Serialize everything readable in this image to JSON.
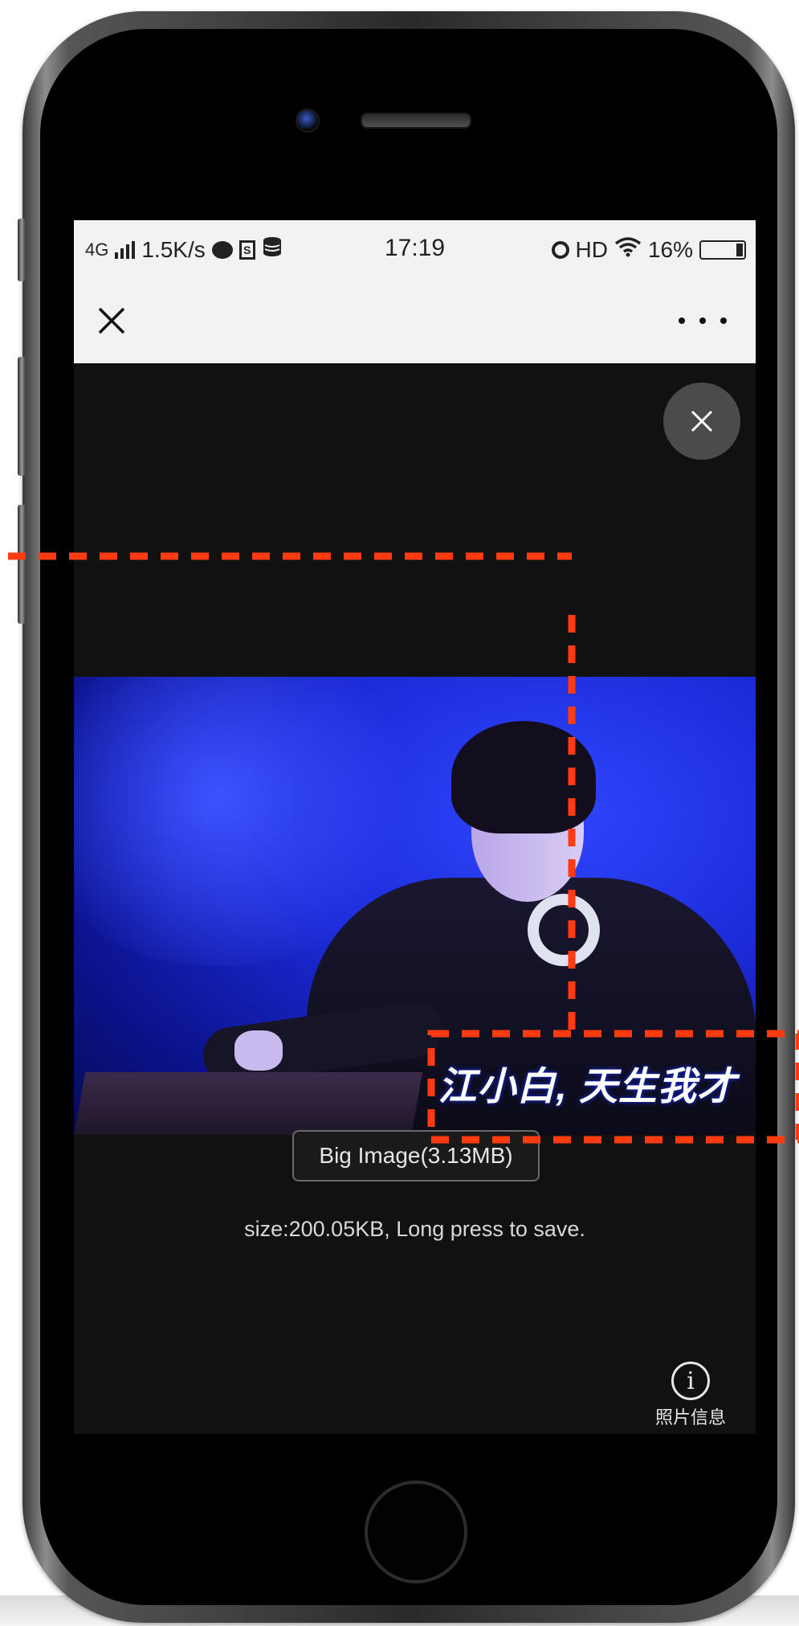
{
  "status_bar": {
    "network": "4G",
    "speed": "1.5K/s",
    "app_icon_label": "S",
    "time": "17:19",
    "hd": "HD",
    "battery": "16%"
  },
  "top_bar": {
    "close_icon": "close-icon",
    "more_icon": "more-icon"
  },
  "viewer": {
    "photo_logo": "江小白, 天生我才",
    "big_image_button": "Big Image(3.13MB)",
    "size_text": "size:200.05KB, Long press to save.",
    "photo_info_label": "照片信息",
    "info_icon_glyph": "i"
  },
  "colors": {
    "annotation": "#ff3b12",
    "screen_bg": "#111111",
    "bar_bg": "#f2f2f2"
  }
}
